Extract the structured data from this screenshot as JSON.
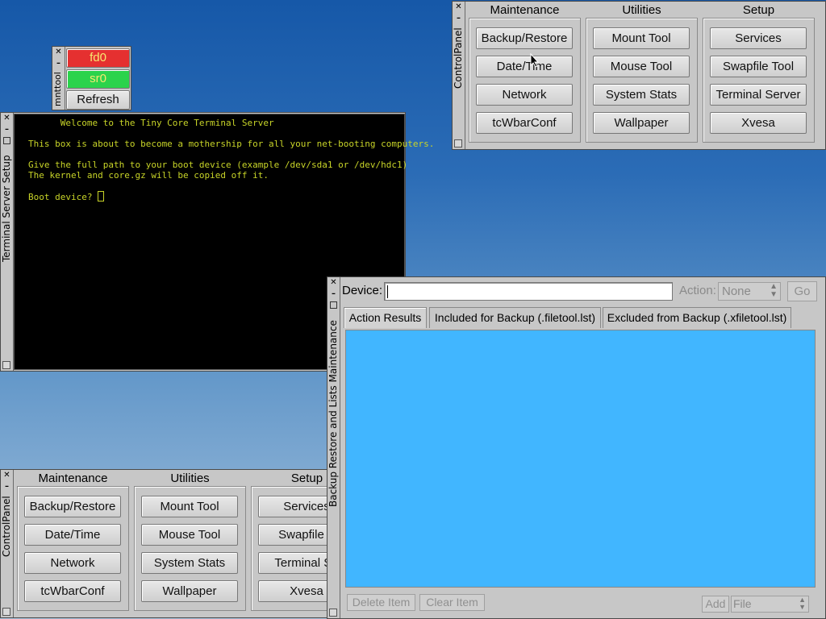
{
  "mnttool": {
    "title": "mnttool",
    "devices": [
      {
        "label": "fd0",
        "color": "#e53030"
      },
      {
        "label": "sr0",
        "color": "#2bd34c"
      }
    ],
    "refresh_label": "Refresh"
  },
  "control_panel": {
    "title": "ControlPanel",
    "groups": [
      {
        "header": "Maintenance",
        "buttons": [
          "Backup/Restore",
          "Date/Time",
          "Network",
          "tcWbarConf"
        ]
      },
      {
        "header": "Utilities",
        "buttons": [
          "Mount Tool",
          "Mouse Tool",
          "System Stats",
          "Wallpaper"
        ]
      },
      {
        "header": "Setup",
        "buttons": [
          "Services",
          "Swapfile Tool",
          "Terminal Server",
          "Xvesa"
        ]
      }
    ]
  },
  "control_panel_clipped": {
    "title": "ControlPanel",
    "groups": [
      {
        "header": "Maintenance",
        "buttons": [
          "Backup/Restore",
          "Date/Time",
          "Network",
          "tcWbarConf"
        ]
      },
      {
        "header": "Utilities",
        "buttons": [
          "Mount Tool",
          "Mouse Tool",
          "System Stats",
          "Wallpaper"
        ]
      },
      {
        "header": "Setup",
        "buttons": [
          "Services",
          "Swapfile T",
          "Terminal Se",
          "Xvesa"
        ]
      }
    ]
  },
  "terminal": {
    "title": "Terminal Server Setup",
    "lines": [
      "      Welcome to the Tiny Core Terminal Server",
      "This box is about to become a mothership for all your net-booting computers.",
      "Give the full path to your boot device (example /dev/sda1 or /dev/hdc1)",
      "The kernel and core.gz will be copied off it.",
      "Boot device? "
    ]
  },
  "backup": {
    "title": "Backup Restore and Lists Maintenance",
    "device_label": "Device:",
    "device_value": "",
    "action_label": "Action:",
    "action_value": "None",
    "go_label": "Go",
    "tabs": [
      "Action Results",
      "Included for Backup (.filetool.lst)",
      "Excluded from Backup (.xfiletool.lst)"
    ],
    "results_color": "#41b6ff",
    "delete_label": "Delete Item",
    "clear_label": "Clear Item",
    "add_label": "Add",
    "file_value": "File"
  }
}
